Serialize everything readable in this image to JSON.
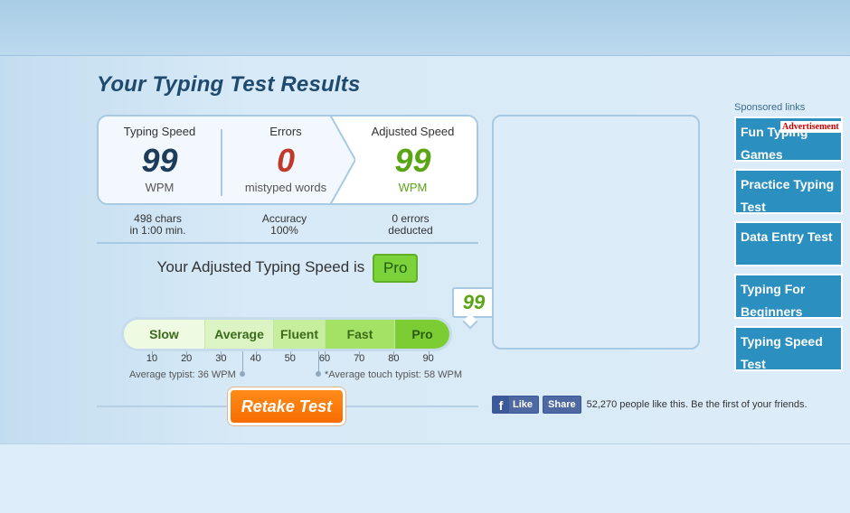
{
  "page": {
    "title": "Your Typing Test Results"
  },
  "results": {
    "speed": {
      "label": "Typing Speed",
      "value": "99",
      "unit": "WPM"
    },
    "errors": {
      "label": "Errors",
      "value": "0",
      "unit": "mistyped words"
    },
    "adjusted": {
      "label": "Adjusted Speed",
      "value": "99",
      "unit": "WPM"
    }
  },
  "details": {
    "chars": "498 chars",
    "time": "in 1:00 min.",
    "accuracy_label": "Accuracy",
    "accuracy_value": "100%",
    "deducted_count": "0 errors",
    "deducted_label": "deducted"
  },
  "level": {
    "prefix": "Your Adjusted Typing Speed is",
    "value": "Pro"
  },
  "scale": {
    "bubble_value": "99",
    "segments": [
      "Slow",
      "Average",
      "Fluent",
      "Fast",
      "Pro"
    ],
    "ticks": [
      "10",
      "20",
      "30",
      "40",
      "50",
      "60",
      "70",
      "80",
      "90"
    ],
    "avg_typist": "Average typist: 36 WPM",
    "avg_touch_typist": "*Average touch typist: 58 WPM",
    "colors": {
      "slow": "#eefae2",
      "average": "#dcf4c4",
      "fluent": "#c5ee9d",
      "fast": "#a3e264",
      "pro": "#7ccd34"
    }
  },
  "actions": {
    "retake": "Retake Test"
  },
  "facebook": {
    "like": "Like",
    "share": "Share",
    "text": "52,270 people like this. Be the first of your friends."
  },
  "sponsored": {
    "label": "Sponsored links",
    "ad_marker": "Advertisement",
    "items": [
      {
        "line1": "Fun Typing",
        "line2": "Games"
      },
      {
        "line1": "Practice Typing",
        "line2": "Test"
      },
      {
        "line1": "Data Entry Test",
        "line2": ""
      },
      {
        "line1": "Typing For",
        "line2": "Beginners"
      },
      {
        "line1": "Typing Speed",
        "line2": "Test"
      }
    ]
  },
  "theme": {
    "accent_green": "#5aa514",
    "error_red": "#c0392b",
    "title_blue": "#1d4a6e",
    "retake_orange": "#f76c00",
    "sponsor_blue": "#2b8fbf"
  }
}
